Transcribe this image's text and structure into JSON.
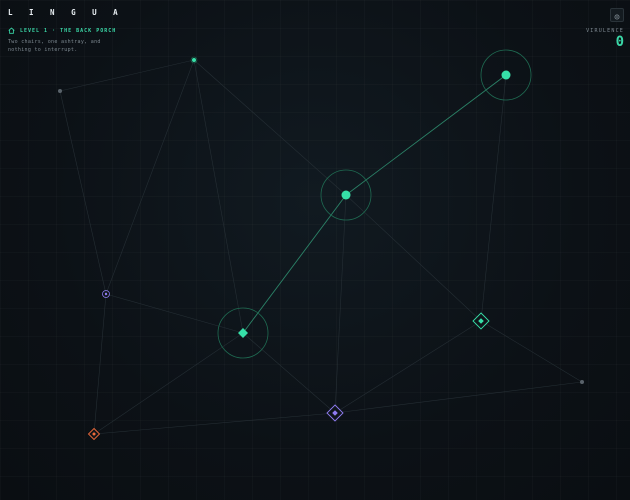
{
  "app": {
    "title": "L I N G U A"
  },
  "level": {
    "label": "LEVEL 1 · THE BACK PORCH",
    "description_line1": "Two chairs, one ashtray, and",
    "description_line2": "nothing to interrupt."
  },
  "stats": {
    "virulence_label": "VIRULENCE",
    "virulence_value": "0"
  },
  "icons": {
    "level": "home-icon",
    "settings": "gear-icon"
  },
  "colors": {
    "infected": "#36e0a8",
    "infected_ring": "#1f6b52",
    "neutral": "#59626a",
    "violet": "#8f7cf0",
    "orange": "#ef6a3a",
    "edge": "#2b343b",
    "active_edge": "#2f8f70"
  },
  "nodes": [
    {
      "id": "n1",
      "kind": "dot",
      "state": "infected",
      "size": "small"
    },
    {
      "id": "n2",
      "kind": "dot",
      "state": "neutral",
      "size": "small"
    },
    {
      "id": "n3",
      "kind": "dot",
      "state": "infected",
      "size": "large"
    },
    {
      "id": "n4",
      "kind": "dot",
      "state": "infected",
      "size": "large"
    },
    {
      "id": "n5",
      "kind": "dot",
      "state": "violet",
      "size": "small"
    },
    {
      "id": "n6",
      "kind": "diamond",
      "state": "infected",
      "size": "large"
    },
    {
      "id": "n7",
      "kind": "diamond",
      "state": "infected_outline",
      "size": "medium"
    },
    {
      "id": "n8",
      "kind": "diamond",
      "state": "violet",
      "size": "medium"
    },
    {
      "id": "n9",
      "kind": "diamond",
      "state": "orange",
      "size": "small"
    },
    {
      "id": "n10",
      "kind": "dot",
      "state": "neutral",
      "size": "small"
    }
  ],
  "edges": [
    {
      "from": "n2",
      "to": "n1",
      "active": false
    },
    {
      "from": "n1",
      "to": "n4",
      "active": false
    },
    {
      "from": "n1",
      "to": "n5",
      "active": false
    },
    {
      "from": "n1",
      "to": "n6",
      "active": false
    },
    {
      "from": "n2",
      "to": "n5",
      "active": false
    },
    {
      "from": "n5",
      "to": "n6",
      "active": false
    },
    {
      "from": "n5",
      "to": "n9",
      "active": false
    },
    {
      "from": "n3",
      "to": "n4",
      "active": true
    },
    {
      "from": "n4",
      "to": "n6",
      "active": true
    },
    {
      "from": "n3",
      "to": "n7",
      "active": false
    },
    {
      "from": "n4",
      "to": "n7",
      "active": false
    },
    {
      "from": "n4",
      "to": "n8",
      "active": false
    },
    {
      "from": "n6",
      "to": "n8",
      "active": false
    },
    {
      "from": "n6",
      "to": "n9",
      "active": false
    },
    {
      "from": "n7",
      "to": "n8",
      "active": false
    },
    {
      "from": "n7",
      "to": "n10",
      "active": false
    },
    {
      "from": "n8",
      "to": "n10",
      "active": false
    },
    {
      "from": "n9",
      "to": "n8",
      "active": false
    }
  ]
}
